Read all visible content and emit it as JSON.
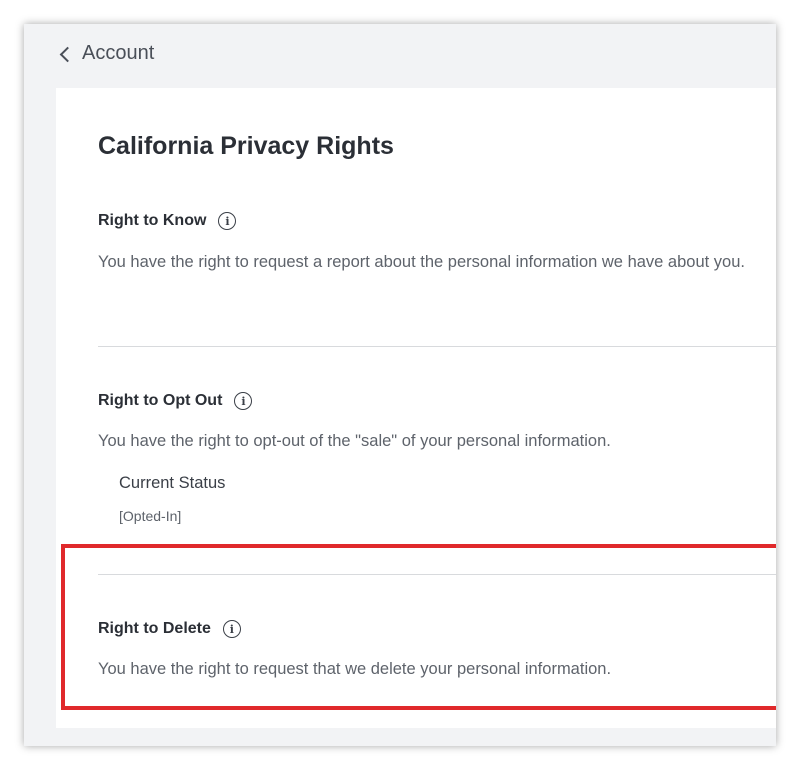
{
  "nav": {
    "back_label": "Account"
  },
  "page": {
    "title": "California Privacy Rights"
  },
  "sections": {
    "right_to_know": {
      "title": "Right to Know",
      "description": "You have the right to request a report about the personal information we have about you."
    },
    "right_to_opt_out": {
      "title": "Right to Opt Out",
      "description": "You have the right to opt-out of the \"sale\" of your personal information.",
      "status_label": "Current Status",
      "status_value": "[Opted-In]"
    },
    "right_to_delete": {
      "title": "Right to Delete",
      "description": "You have the right to request that we delete your personal information."
    }
  },
  "icons": {
    "info": "i"
  },
  "colors": {
    "highlight": "#e0292b",
    "background": "#f2f3f5",
    "card": "#ffffff",
    "heading": "#2b2f36",
    "body_text": "#5e636b"
  }
}
